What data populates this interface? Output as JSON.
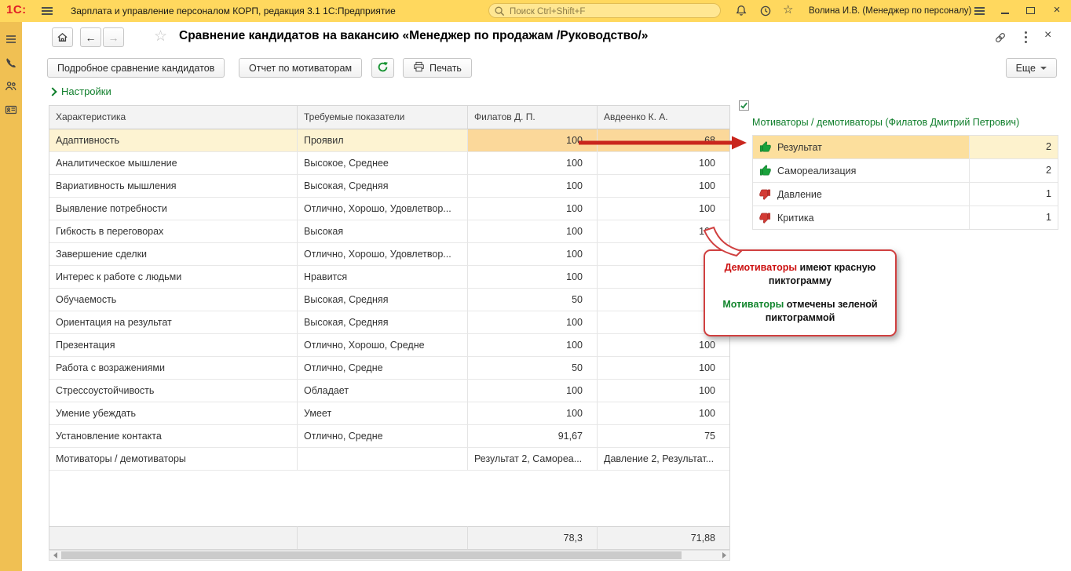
{
  "topbar": {
    "logo": "1С:",
    "app_title": "Зарплата и управление персоналом КОРП, редакция 3.1 1С:Предприятие",
    "search_placeholder": "Поиск Ctrl+Shift+F",
    "user_name": "Волина И.В. (Менеджер по персоналу)"
  },
  "header": {
    "title": "Сравнение кандидатов на вакансию «Менеджер по продажам /Руководство/»"
  },
  "toolbar": {
    "detailed": "Подробное сравнение кандидатов",
    "motivators": "Отчет по мотиваторам",
    "print": "Печать",
    "more": "Еще"
  },
  "settings_label": "Настройки",
  "table": {
    "columns": [
      "Характеристика",
      "Требуемые показатели",
      "Филатов Д. П.",
      "Авдеенко К. А."
    ],
    "rows": [
      {
        "cells": [
          "Адаптивность",
          "Проявил",
          "100",
          "68"
        ],
        "selected": true
      },
      {
        "cells": [
          "Аналитическое мышление",
          "Высокое, Среднее",
          "100",
          "100"
        ]
      },
      {
        "cells": [
          "Вариативность мышления",
          "Высокая, Средняя",
          "100",
          "100"
        ]
      },
      {
        "cells": [
          "Выявление потребности",
          "Отлично, Хорошо, Удовлетвор...",
          "100",
          "100"
        ]
      },
      {
        "cells": [
          "Гибкость в переговорах",
          "Высокая",
          "100",
          "100"
        ]
      },
      {
        "cells": [
          "Завершение сделки",
          "Отлично, Хорошо, Удовлетвор...",
          "100",
          ""
        ]
      },
      {
        "cells": [
          "Интерес к работе с людьми",
          "Нравится",
          "100",
          ""
        ]
      },
      {
        "cells": [
          "Обучаемость",
          "Высокая, Средняя",
          "50",
          ""
        ]
      },
      {
        "cells": [
          "Ориентация на результат",
          "Высокая, Средняя",
          "100",
          ""
        ]
      },
      {
        "cells": [
          "Презентация",
          "Отлично, Хорошо, Средне",
          "100",
          "100"
        ]
      },
      {
        "cells": [
          "Работа с возражениями",
          "Отлично, Средне",
          "50",
          "100"
        ]
      },
      {
        "cells": [
          "Стрессоустойчивость",
          "Обладает",
          "100",
          "100"
        ]
      },
      {
        "cells": [
          "Умение убеждать",
          "Умеет",
          "100",
          "100"
        ]
      },
      {
        "cells": [
          "Установление контакта",
          "Отлично, Средне",
          "91,67",
          "75"
        ]
      },
      {
        "cells": [
          "Мотиваторы / демотиваторы",
          "",
          "Результат 2, Самореа...",
          "Давление 2, Результат..."
        ]
      }
    ],
    "totals": {
      "filatov": "78,3",
      "avdeenko": "71,88"
    }
  },
  "panel": {
    "title": "Мотиваторы / демотиваторы (Филатов Дмитрий Петрович)",
    "items": [
      {
        "icon": "thumb-up-icon",
        "label": "Результат",
        "value": "2",
        "selected": true
      },
      {
        "icon": "thumb-up-icon",
        "label": "Самореализация",
        "value": "2"
      },
      {
        "icon": "thumb-down-icon",
        "label": "Давление",
        "value": "1"
      },
      {
        "icon": "thumb-down-icon",
        "label": "Критика",
        "value": "1"
      }
    ]
  },
  "callout": {
    "line1_accent": "Демотиваторы",
    "line1_rest": " имеют красную пиктограмму",
    "line2_accent": "Мотиваторы",
    "line2_rest": " отмечены зеленой пиктограммой"
  },
  "colors": {
    "topbar_yellow": "#ffd85e",
    "sidebar_yellow": "#f0c053",
    "accent_green": "#0f7e2b",
    "selected_row": "#fdf3d2",
    "selected_value_cell": "#fbd89a",
    "arrow_red": "#c9261d",
    "motivator_green": "#1aa23c",
    "demotivator_red": "#d33b35"
  }
}
